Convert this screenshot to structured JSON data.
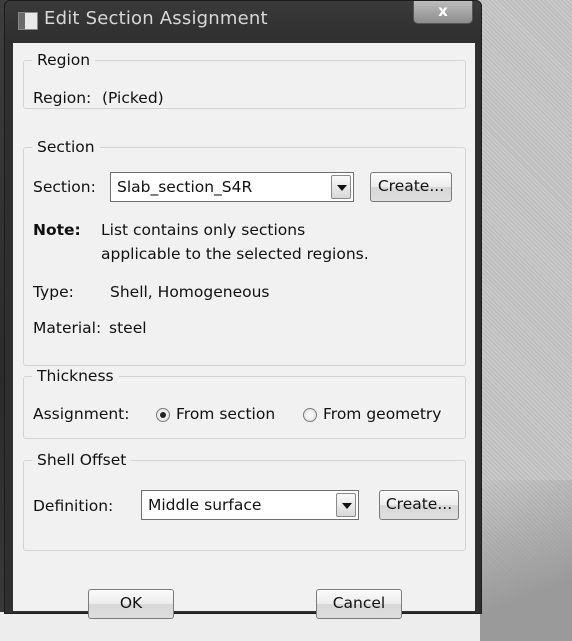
{
  "window": {
    "title": "Edit Section Assignment",
    "close_glyph": "x"
  },
  "region": {
    "legend": "Region",
    "label": "Region:",
    "value": "(Picked)"
  },
  "section": {
    "legend": "Section",
    "label": "Section:",
    "selected": "Slab_section_S4R",
    "create_label": "Create...",
    "note_label": "Note:",
    "note_line1": "List contains only sections",
    "note_line2": "applicable to the selected regions.",
    "type_label": "Type:",
    "type_value": "Shell, Homogeneous",
    "material_label": "Material:",
    "material_value": "steel"
  },
  "thickness": {
    "legend": "Thickness",
    "assignment_label": "Assignment:",
    "options": [
      {
        "label": "From section",
        "checked": true
      },
      {
        "label": "From geometry",
        "checked": false
      }
    ]
  },
  "shell_offset": {
    "legend": "Shell Offset",
    "definition_label": "Definition:",
    "selected": "Middle surface",
    "create_label": "Create..."
  },
  "buttons": {
    "ok": "OK",
    "cancel": "Cancel"
  },
  "icons": {
    "window_icon": "window-icon",
    "dropdown": "chevron-down-icon",
    "close": "close-icon"
  }
}
